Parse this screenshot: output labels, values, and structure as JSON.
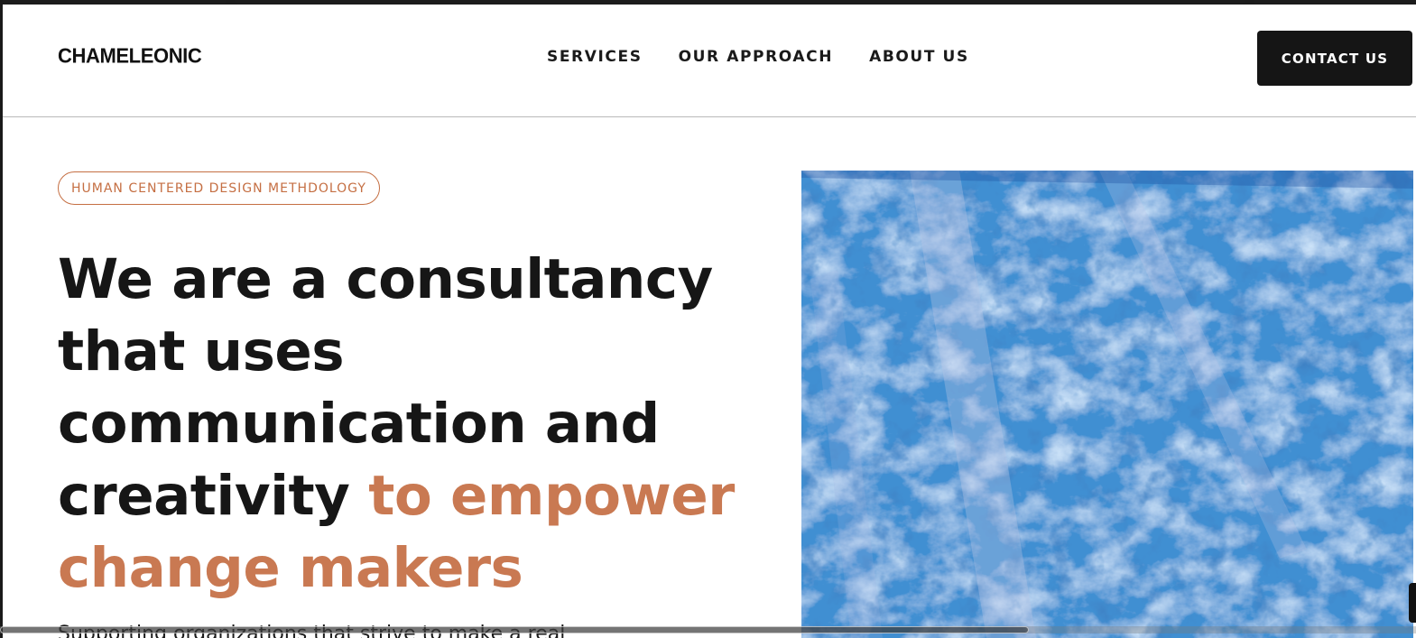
{
  "header": {
    "logo": "CHAMELEONIC",
    "nav": [
      {
        "label": "SERVICES"
      },
      {
        "label": "OUR APPROACH"
      },
      {
        "label": "ABOUT US"
      }
    ],
    "contact_label": "CONTACT US"
  },
  "hero": {
    "tag": "HUMAN CENTERED DESIGN METHDOLOGY",
    "headline_main": "We are a consultancy that uses communication and creativity",
    "headline_accent": "to empower change makers",
    "subtext": "Supporting organizations that strive to make a real",
    "image": "glacier-ice-image"
  },
  "colors": {
    "accent": "#c97952",
    "pill": "#c56f43",
    "dark": "#151515",
    "ice": "#2f7fc4"
  }
}
